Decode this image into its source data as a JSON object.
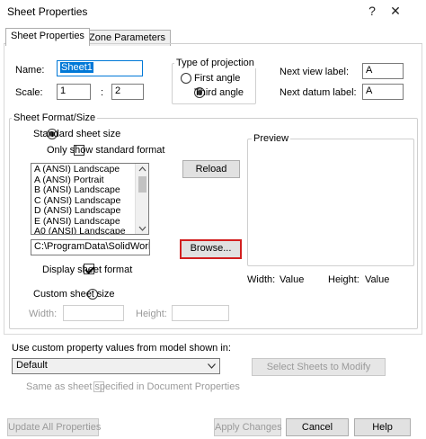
{
  "window": {
    "title": "Sheet Properties",
    "help_glyph": "?",
    "close_glyph": "✕"
  },
  "tabs": [
    {
      "label": "Sheet Properties"
    },
    {
      "label": "Zone Parameters"
    }
  ],
  "sheet": {
    "name_label": "Name:",
    "name_value": "Sheet1",
    "scale_label": "Scale:",
    "scale_num": "1",
    "scale_sep": ":",
    "scale_den": "2"
  },
  "projection": {
    "title": "Type of projection",
    "first_angle": "First angle",
    "third_angle": "Third angle",
    "selected": "third_angle"
  },
  "labels": {
    "next_view_label": "Next view label:",
    "next_view_value": "A",
    "next_datum_label": "Next datum label:",
    "next_datum_value": "A"
  },
  "format": {
    "group_title": "Sheet Format/Size",
    "standard_size": "Standard sheet size",
    "only_standard": "Only show standard format",
    "sizes": [
      "A (ANSI) Landscape",
      "A (ANSI) Portrait",
      "B (ANSI) Landscape",
      "C (ANSI) Landscape",
      "D (ANSI) Landscape",
      "E (ANSI) Landscape",
      "A0 (ANSI) Landscape"
    ],
    "reload_label": "Reload",
    "path_value": "C:\\ProgramData\\SolidWork:",
    "browse_label": "Browse...",
    "display_format": "Display sheet format",
    "custom_size": "Custom sheet size",
    "width_label": "Width:",
    "height_label": "Height:"
  },
  "preview": {
    "title": "Preview",
    "width_label": "Width:",
    "width_value": "Value",
    "height_label": "Height:",
    "height_value": "Value"
  },
  "custom_props": {
    "label": "Use custom property values from model shown in:",
    "combo_value": "Default",
    "select_sheets": "Select Sheets to Modify",
    "same_as": "Same as sheet specified in Document Properties"
  },
  "footer": {
    "update_all": "Update All Properties",
    "apply": "Apply Changes",
    "cancel": "Cancel",
    "help": "Help"
  }
}
